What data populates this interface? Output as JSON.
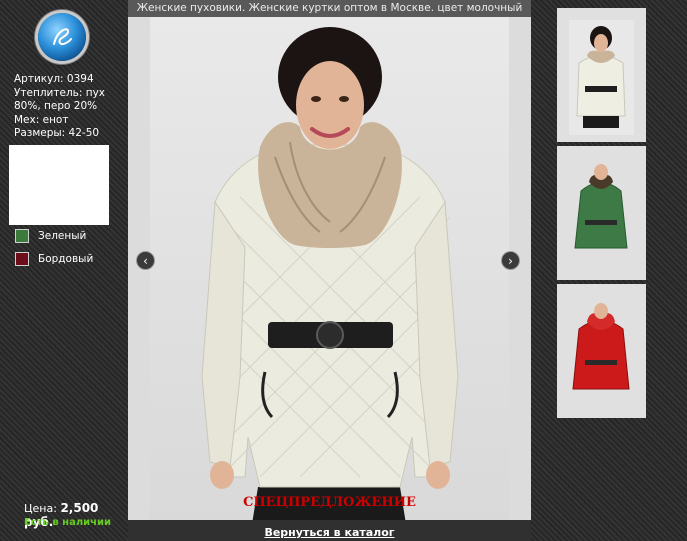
{
  "header": {
    "title": "Женские пуховики. Женские куртки оптом в Москве. цвет молочный"
  },
  "product": {
    "article": "Артикул: 0394",
    "filling": "Утеплитель: пух 80%, перо 20%",
    "fur": "Мех: енот",
    "sizes": "Размеры: 42-50"
  },
  "colors": [
    {
      "label": "Зеленый",
      "hex": "#3c7a3c"
    },
    {
      "label": "Бордовый",
      "hex": "#6b0d1a"
    }
  ],
  "price": {
    "label": "Цена:",
    "value": "2,500 руб."
  },
  "stock": "Есть в наличии",
  "special_offer": "СПЕЦПРЕДЛОЖЕНИЕ",
  "back_link": "Вернуться в каталог",
  "thumbnails": [
    {
      "color": "молочный",
      "hex": "#eeeee2"
    },
    {
      "color": "зеленый",
      "hex": "#3d7a45"
    },
    {
      "color": "красный",
      "hex": "#cc1a1a"
    }
  ],
  "icons": {
    "prev": "chevron-left-icon",
    "next": "chevron-right-icon",
    "logo": "logo-icon"
  }
}
